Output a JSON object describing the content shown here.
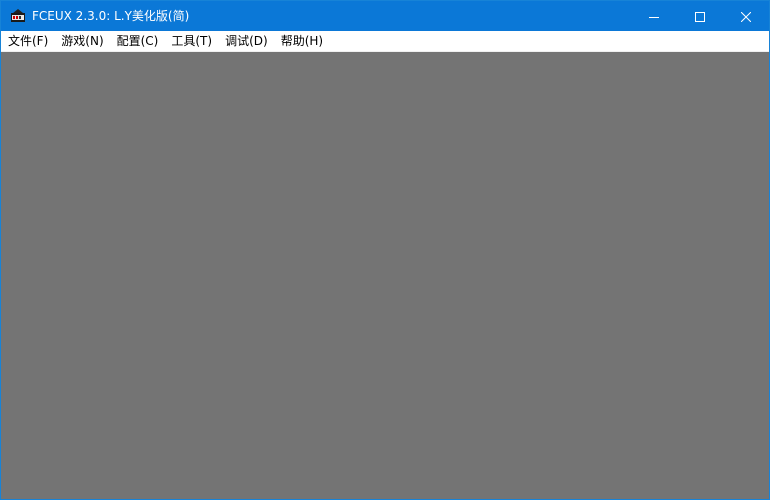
{
  "window": {
    "title": "FCEUX 2.3.0: L.Y美化版(简)",
    "icon": "fceux-app-icon",
    "controls": [
      "minimize-icon",
      "maximize-icon",
      "close-icon"
    ]
  },
  "menubar": {
    "items": [
      {
        "label": "文件(F)"
      },
      {
        "label": "游戏(N)"
      },
      {
        "label": "配置(C)"
      },
      {
        "label": "工具(T)"
      },
      {
        "label": "调试(D)"
      },
      {
        "label": "帮助(H)"
      }
    ]
  },
  "colors": {
    "titlebar": "#0b78d7",
    "client_background": "#747474",
    "menubar": "#ffffff"
  }
}
